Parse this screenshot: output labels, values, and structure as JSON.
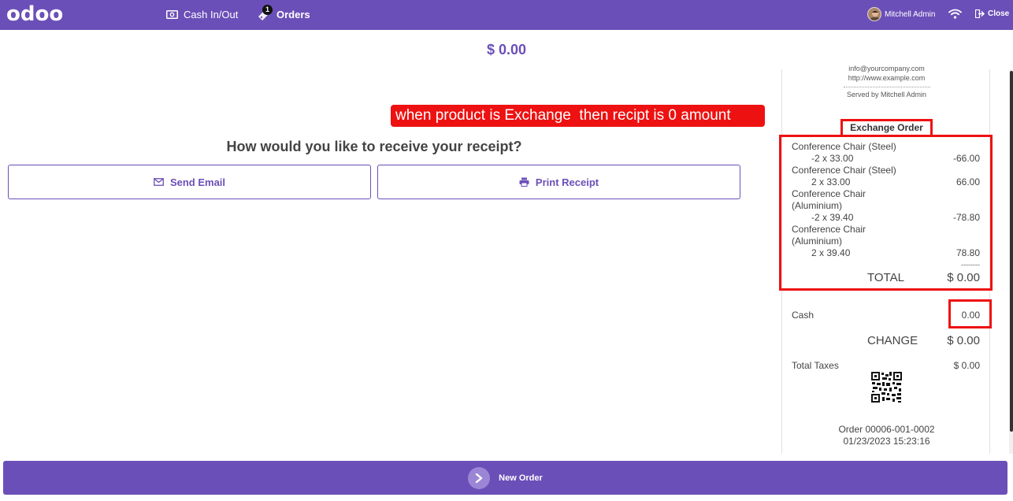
{
  "header": {
    "logo": "odoo",
    "cash_in_out": "Cash In/Out",
    "orders": "Orders",
    "orders_badge": "1",
    "user": "Mitchell Admin",
    "close": "Close"
  },
  "amount_due": "$ 0.00",
  "annotation": "when product is Exchange  then recipt is 0 amount",
  "receipt_question": "How would you like to receive your receipt?",
  "buttons": {
    "send_email": "Send Email",
    "print_receipt": "Print Receipt",
    "new_order": "New Order"
  },
  "receipt": {
    "email": "info@yourcompany.com",
    "website": "http://www.example.com",
    "served_by": "Served by Mitchell Admin",
    "title": "Exchange Order",
    "lines": [
      {
        "name": "Conference Chair (Steel)",
        "qty": "-2 x 33.00",
        "price": "-66.00"
      },
      {
        "name": "Conference Chair (Steel)",
        "qty": "2 x 33.00",
        "price": "66.00"
      },
      {
        "name": "Conference Chair",
        "name2": "(Aluminium)",
        "qty": "-2 x 39.40",
        "price": "-78.80"
      },
      {
        "name": "Conference Chair",
        "name2": "(Aluminium)",
        "qty": "2 x 39.40",
        "price": "78.80"
      }
    ],
    "dashes": "--------",
    "total_label": "TOTAL",
    "total_value": "$ 0.00",
    "cash_label": "Cash",
    "cash_value": "0.00",
    "change_label": "CHANGE",
    "change_value": "$ 0.00",
    "taxes_label": "Total Taxes",
    "taxes_value": "$ 0.00",
    "order_ref": "Order 00006-001-0002",
    "order_date": "01/23/2023 15:23:16"
  }
}
